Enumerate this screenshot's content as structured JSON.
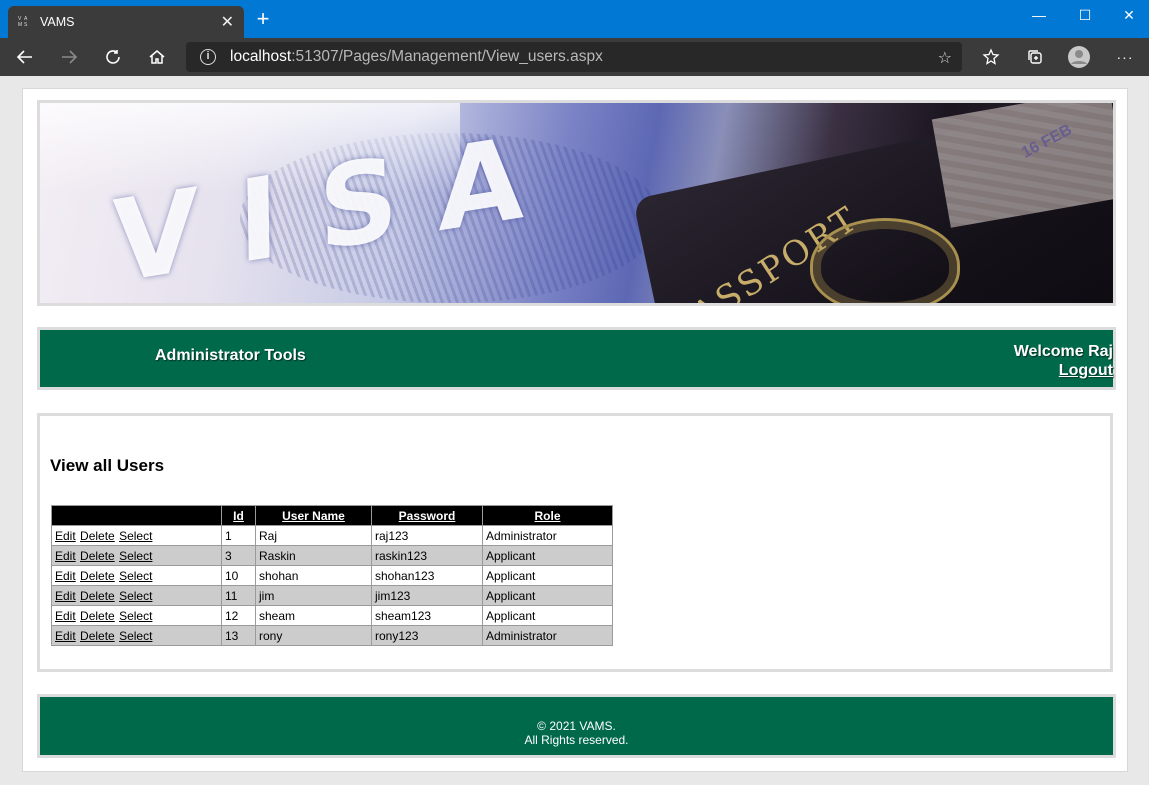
{
  "browser": {
    "tab_title": "VAMS",
    "favicon_text": "VAMS",
    "url_host": "localhost",
    "url_path": ":51307/Pages/Management/View_users.aspx"
  },
  "header": {
    "admin_title": "Administrator Tools",
    "welcome": "Welcome Raj",
    "logout": "Logout"
  },
  "banner": {
    "visa_text": "VISA",
    "passport_text": "PASSPORT",
    "stamp_text": "16 FEB"
  },
  "main": {
    "title": "View all Users",
    "table": {
      "headers": [
        "",
        "Id",
        "User Name",
        "Password",
        "Role"
      ],
      "row_actions": [
        "Edit",
        "Delete",
        "Select"
      ],
      "rows": [
        {
          "id": "1",
          "username": "Raj",
          "password": "raj123",
          "role": "Administrator"
        },
        {
          "id": "3",
          "username": "Raskin",
          "password": "raskin123",
          "role": "Applicant"
        },
        {
          "id": "10",
          "username": "shohan",
          "password": "shohan123",
          "role": "Applicant"
        },
        {
          "id": "11",
          "username": "jim",
          "password": "jim123",
          "role": "Applicant"
        },
        {
          "id": "12",
          "username": "sheam",
          "password": "sheam123",
          "role": "Applicant"
        },
        {
          "id": "13",
          "username": "rony",
          "password": "rony123",
          "role": "Administrator"
        }
      ]
    }
  },
  "footer": {
    "line1": "© 2021 VAMS.",
    "line2": "All Rights reserved."
  },
  "colors": {
    "accent_green": "#00694a",
    "browser_blue": "#0078d4"
  }
}
